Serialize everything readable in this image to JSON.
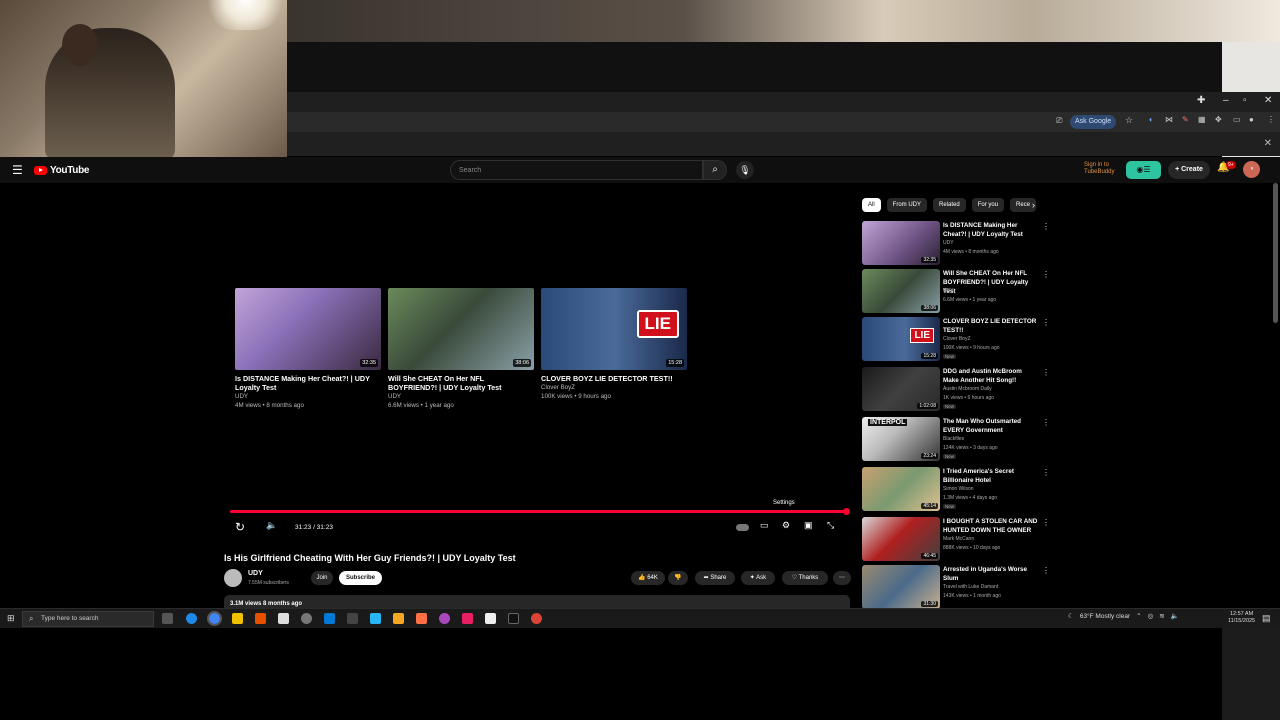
{
  "browser": {
    "ask_google": "Ask Google"
  },
  "masthead": {
    "logo_text": "YouTube",
    "search_placeholder": "Search",
    "tubebuddy_text": "Sign in to TubeBuddy",
    "create_label": "Create",
    "bell_badge": "9+"
  },
  "player": {
    "end_cards": [
      {
        "title": "Is DISTANCE Making Her Cheat?! | UDY Loyalty Test",
        "channel": "UDY",
        "meta": "4M views • 8 months ago",
        "duration": "32:35"
      },
      {
        "title": "Will She CHEAT On Her NFL BOYFRIEND?! | UDY Loyalty Test",
        "channel": "UDY",
        "meta": "6.6M views • 1 year ago",
        "duration": "38:06"
      },
      {
        "title": "CLOVER BOYZ LIE DETECTOR TEST!!",
        "channel": "Clover BoyZ",
        "meta": "100K views • 9 hours ago",
        "duration": "15:28",
        "thumb_text": "LIE"
      }
    ],
    "time_display": "31:23 / 31:23",
    "settings_tooltip": "Settings",
    "progress_fraction": 1.0
  },
  "video": {
    "title": "Is His Girlfriend Cheating With Her Guy Friends?! | UDY Loyalty Test",
    "channel": "UDY",
    "subscribers": "7.55M subscribers",
    "join_label": "Join",
    "subscribe_label": "Subscribe",
    "likes": "64K",
    "share_label": "Share",
    "ask_label": "Ask",
    "thanks_label": "Thanks",
    "description_meta": "3.1M views  8 months ago"
  },
  "sidebar": {
    "chips": [
      "All",
      "From UDY",
      "Related",
      "For you",
      "Rece"
    ],
    "recommendations": [
      {
        "title": "Is DISTANCE Making Her Cheat?! | UDY Loyalty Test",
        "channel": "UDY",
        "meta": "4M views • 8 months ago",
        "duration": "32:35",
        "new": ""
      },
      {
        "title": "Will She CHEAT On Her NFL BOYFRIEND?! | UDY Loyalty Test",
        "channel": "UDY",
        "meta": "6.6M views • 1 year ago",
        "duration": "38:06",
        "new": ""
      },
      {
        "title": "CLOVER BOYZ LIE DETECTOR TEST!!",
        "channel": "Clover BoyZ",
        "meta": "100K views • 9 hours ago",
        "duration": "15:28",
        "new": "New",
        "thumb_text": "LIE"
      },
      {
        "title": "DDG and Austin McBroom Make Another Hit Song!!",
        "channel": "Austin Mcbroom Daily",
        "meta": "1K views • 6 hours ago",
        "duration": "1:02:08",
        "new": "New"
      },
      {
        "title": "The Man Who Outsmarted EVERY Government",
        "channel": "Blackfiles",
        "meta": "124K views • 3 days ago",
        "duration": "23:24",
        "new": "New",
        "thumb_text": "INTERPOL"
      },
      {
        "title": "I Tried America's Secret Billionaire Hotel",
        "channel": "Simon Wilson",
        "meta": "1.3M views • 4 days ago",
        "duration": "45:14",
        "new": "New"
      },
      {
        "title": "I BOUGHT A STOLEN CAR AND HUNTED DOWN THE OWNER",
        "channel": "Mark McCann",
        "meta": "888K views • 10 days ago",
        "duration": "46:45",
        "new": ""
      },
      {
        "title": "Arrested in Uganda's Worse Slum",
        "channel": "Travel with Luke Damant",
        "meta": "143K views • 1 month ago",
        "duration": "31:30",
        "new": ""
      }
    ]
  },
  "taskbar": {
    "search_placeholder": "Type here to search",
    "weather": "63°F  Mostly clear",
    "time": "12:57 AM",
    "date": "11/15/2025"
  }
}
